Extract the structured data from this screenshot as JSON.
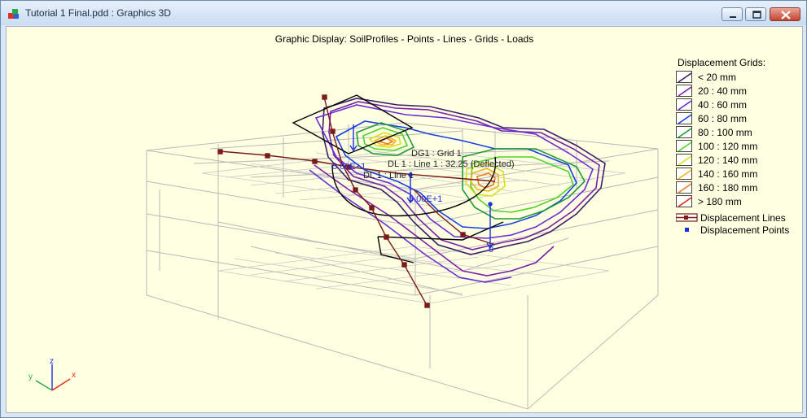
{
  "window": {
    "title": "Tutorial 1 Final.pdd : Graphics 3D",
    "controls": [
      "minimize",
      "maximize",
      "close"
    ]
  },
  "graphic": {
    "header": "Graphic Display: SoilProfiles - Points - Lines - Grids - Loads",
    "labels": {
      "grid": "DG1 : Grid 1",
      "line": "DL 1 : Line 1",
      "deflected": "DL 1 : Line 1 : 32.25 (Deflected)",
      "value_a": "5.00E+1",
      "value_b": "5.00E+1",
      "zero": "0"
    }
  },
  "legend": {
    "title": "Displacement Grids:",
    "items": [
      {
        "label": "< 20 mm",
        "color": "#3a1f6b"
      },
      {
        "label": "20 : 40 mm",
        "color": "#7a1fa8"
      },
      {
        "label": "40 : 60 mm",
        "color": "#6b2bd8"
      },
      {
        "label": "60 : 80 mm",
        "color": "#1a3fe0"
      },
      {
        "label": "80 : 100 mm",
        "color": "#1f9a3a"
      },
      {
        "label": "100 : 120 mm",
        "color": "#4fd22a"
      },
      {
        "label": "120 : 140 mm",
        "color": "#d8e01a"
      },
      {
        "label": "140 : 160 mm",
        "color": "#f0b41a"
      },
      {
        "label": "160 : 180 mm",
        "color": "#f07818"
      },
      {
        "label": "> 180 mm",
        "color": "#e02a10"
      }
    ],
    "lines_label": "Displacement Lines",
    "points_label": "Displacement Points",
    "lines_color": "#7a1a1a",
    "points_color": "#1a2fe0"
  },
  "axes": {
    "x": "x",
    "y": "y",
    "z": "z"
  }
}
